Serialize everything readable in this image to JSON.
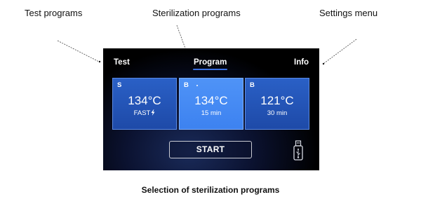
{
  "callouts": {
    "test": "Test programs",
    "sterilization": "Sterilization programs",
    "settings": "Settings menu"
  },
  "screen": {
    "tabs": [
      {
        "label": "Test",
        "active": false
      },
      {
        "label": "Program",
        "active": true
      },
      {
        "label": "Info",
        "active": false
      }
    ],
    "programs": [
      {
        "letter": "S",
        "temp": "134°C",
        "detail": "FAST",
        "icon": "lightning-icon",
        "selected": false
      },
      {
        "letter": "B",
        "temp": "134°C",
        "detail": "15 min",
        "selected": true
      },
      {
        "letter": "B",
        "temp": "121°C",
        "detail": "30 min",
        "selected": false
      }
    ],
    "start_label": "START",
    "usb_icon": "usb-icon"
  },
  "caption": "Selection of sterilization programs",
  "colors": {
    "card": "#2456b8",
    "card_selected": "#4a8df5",
    "accent_underline": "#3a6fe0",
    "screen_bg": "#000000"
  }
}
